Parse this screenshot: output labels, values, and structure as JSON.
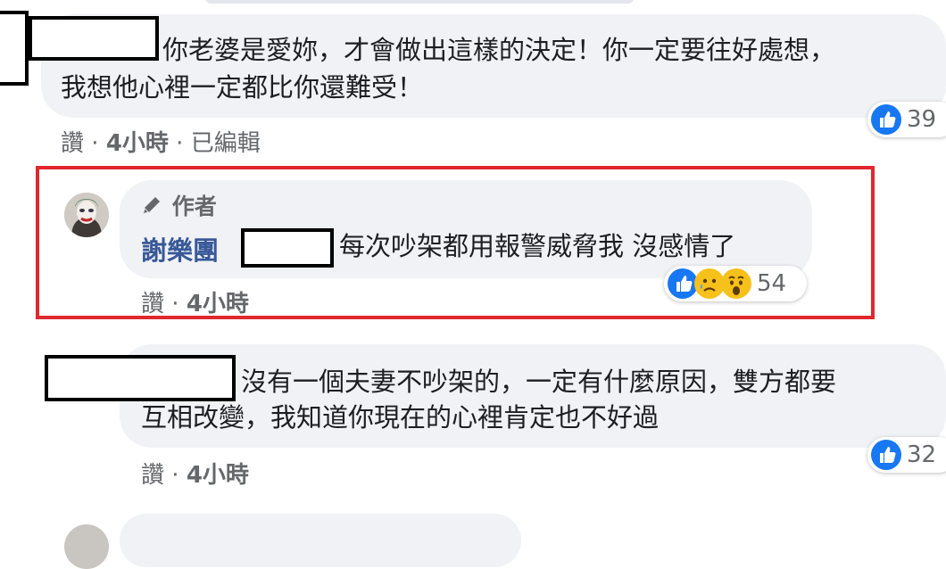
{
  "comments": [
    {
      "text_line1": "你老婆是愛妳，才會做出這樣的決定！你一定要往好處想，",
      "text_line2": "我想他心裡一定都比你還難受！",
      "like_label": "讚",
      "time": "4小時",
      "edited": "已編輯",
      "reaction_count": "39"
    },
    {
      "author_badge": "作者",
      "author_name": "謝樂團",
      "text": "每次吵架都用報警威脅我 沒感情了",
      "like_label": "讚",
      "time": "4小時",
      "reaction_count": "54"
    },
    {
      "text_line1": "沒有一個夫妻不吵架的，一定有什麼原因，雙方都要",
      "text_line2": "互相改變，我知道你現在的心裡肯定也不好過",
      "like_label": "讚",
      "time": "4小時",
      "reaction_count": "32"
    }
  ],
  "colors": {
    "highlight_border": "#e0282e",
    "like_blue": "#1877f2",
    "bubble_bg": "#f0f2f5",
    "meta_text": "#65676b"
  },
  "icons": [
    "like-icon",
    "sad-icon",
    "wow-icon",
    "pencil-icon"
  ]
}
